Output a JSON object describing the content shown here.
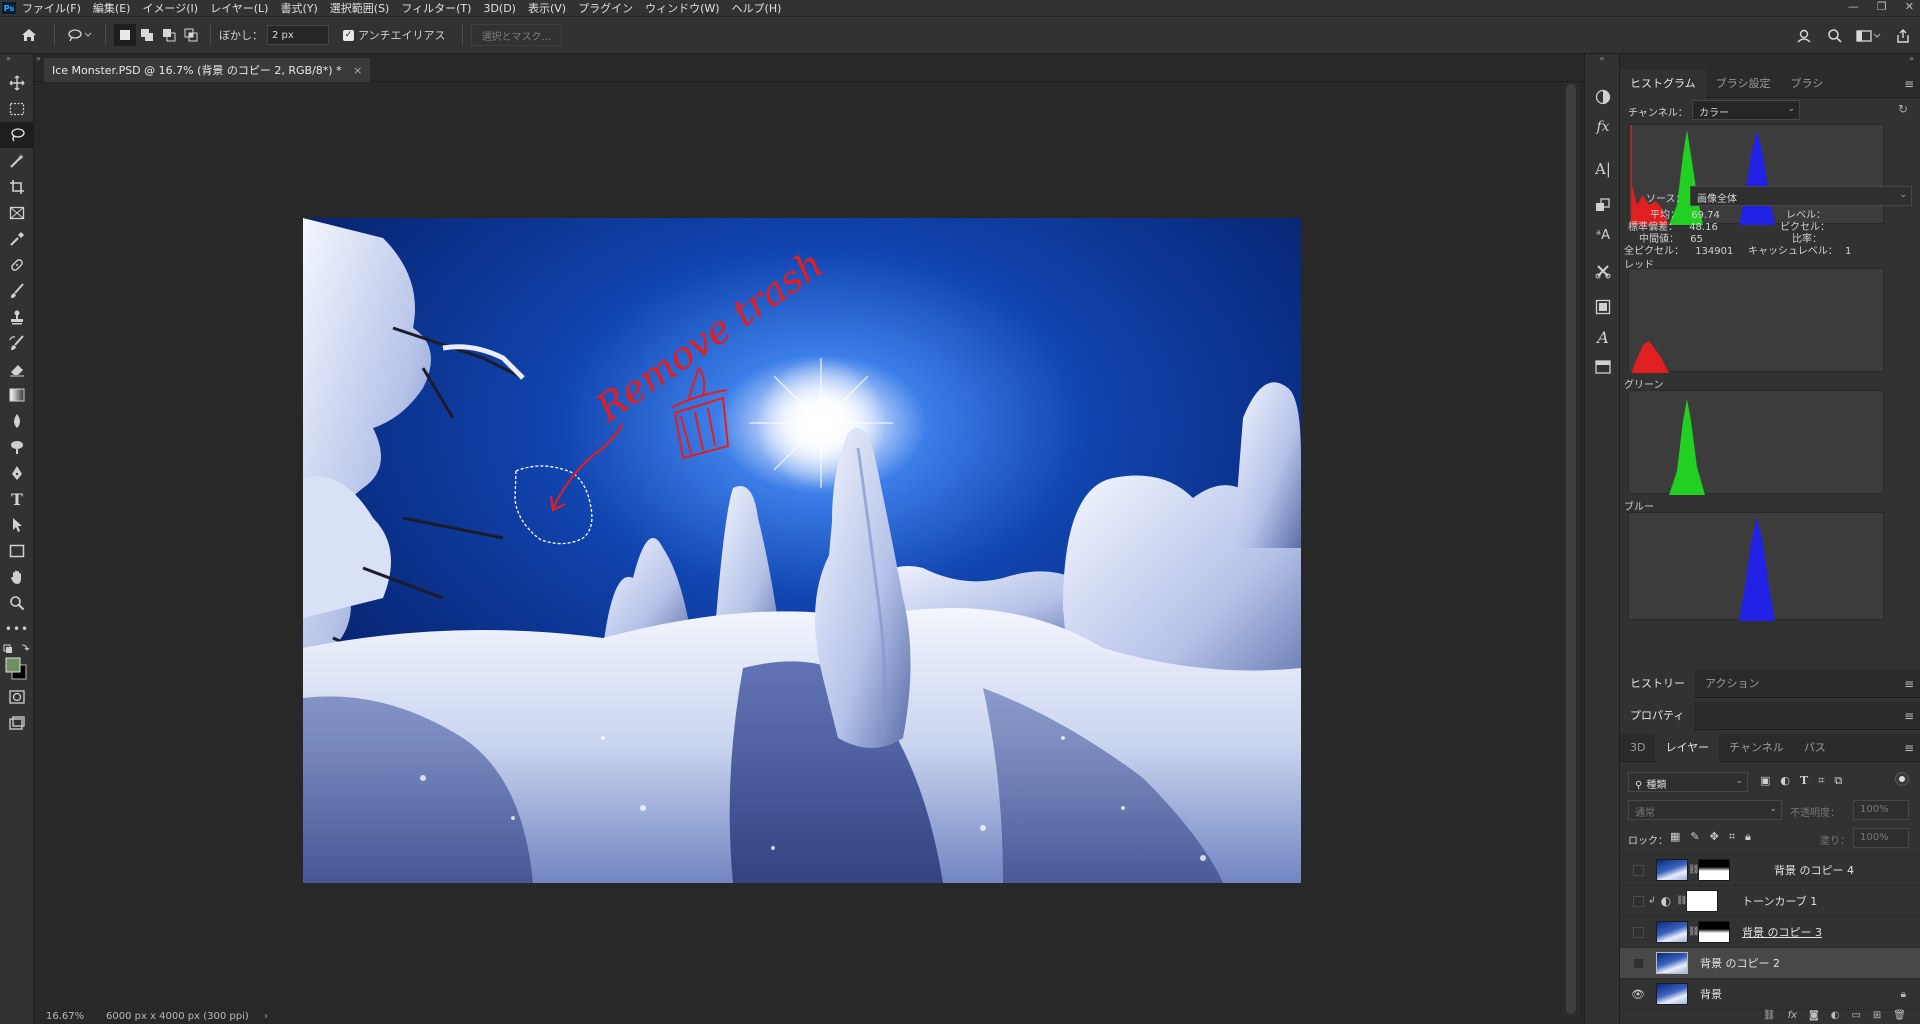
{
  "app": {
    "logo": "Ps",
    "menus": [
      "ファイル(F)",
      "編集(E)",
      "イメージ(I)",
      "レイヤー(L)",
      "書式(Y)",
      "選択範囲(S)",
      "フィルター(T)",
      "3D(D)",
      "表示(V)",
      "プラグイン",
      "ウィンドウ(W)",
      "ヘルプ(H)"
    ]
  },
  "options": {
    "feather_label": "ぼかし：",
    "feather_value": "2 px",
    "antialias_label": "アンチエイリアス",
    "antialias_checked": true,
    "select_mask_label": "選択とマスク..."
  },
  "document": {
    "tab_title": "Ice Monster.PSD @ 16.7% (背景 のコピー 2, RGB/8*) *",
    "annotation_text": "Remove trash"
  },
  "status": {
    "zoom": "16.67%",
    "doc_info": "6000 px x 4000 px (300 ppi)"
  },
  "histogram": {
    "tabs": [
      "ヒストグラム",
      "ブラシ設定",
      "ブラシ"
    ],
    "channel_label": "チャンネル：",
    "channel_value": "カラー",
    "source_label": "ソース：",
    "source_value": "画像全体",
    "stats_left": [
      {
        "label": "平均：",
        "value": "69.74"
      },
      {
        "label": "標準偏差：",
        "value": "48.16"
      },
      {
        "label": "中間値：",
        "value": "65"
      },
      {
        "label": "全ピクセル：",
        "value": "134901"
      }
    ],
    "stats_right": [
      {
        "label": "レベル：",
        "value": ""
      },
      {
        "label": "ピクセル：",
        "value": ""
      },
      {
        "label": "比率：",
        "value": ""
      },
      {
        "label": "キャッシュレベル：",
        "value": "1"
      }
    ],
    "channels": [
      {
        "name": "レッド",
        "color": "#e02020"
      },
      {
        "name": "グリーン",
        "color": "#22d022"
      },
      {
        "name": "ブルー",
        "color": "#2222e6"
      }
    ]
  },
  "history_panel": {
    "tabs": [
      "ヒストリー",
      "アクション"
    ]
  },
  "properties_panel": {
    "tabs": [
      "プロパティ"
    ]
  },
  "layers_panel": {
    "tabs": [
      "3D",
      "レイヤー",
      "チャンネル",
      "パス"
    ],
    "filter_kind": "種類",
    "blend_mode": "通常",
    "opacity_label": "不透明度：",
    "opacity_value": "100%",
    "lock_label": "ロック：",
    "fill_label": "塗り：",
    "fill_value": "100%",
    "layers": [
      {
        "name": "背景 のコピー 4",
        "visible": false,
        "selected": false
      },
      {
        "name": "トーンカーブ 1",
        "visible": false,
        "selected": false
      },
      {
        "name": "背景 のコピー 3",
        "visible": false,
        "selected": false
      },
      {
        "name": "背景 のコピー 2",
        "visible": false,
        "selected": true
      },
      {
        "name": "背景",
        "visible": true,
        "selected": false
      }
    ]
  }
}
